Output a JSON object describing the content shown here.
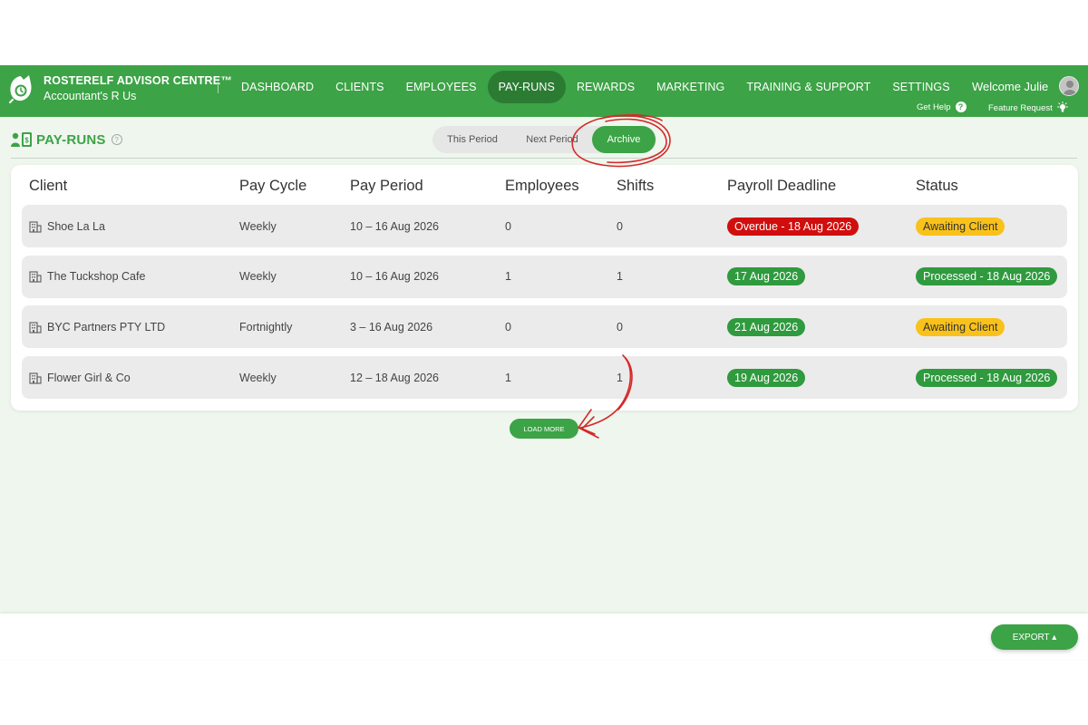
{
  "header": {
    "brand_title": "ROSTERELF ADVISOR CENTRE™",
    "brand_subtitle": "Accountant's R Us",
    "nav": [
      {
        "label": "DASHBOARD"
      },
      {
        "label": "CLIENTS"
      },
      {
        "label": "EMPLOYEES"
      },
      {
        "label": "PAY-RUNS",
        "active": true
      },
      {
        "label": "REWARDS"
      },
      {
        "label": "MARKETING"
      },
      {
        "label": "TRAINING & SUPPORT"
      },
      {
        "label": "SETTINGS"
      }
    ],
    "welcome": "Welcome Julie",
    "get_help": "Get Help",
    "feature_request": "Feature Request"
  },
  "page": {
    "title": "PAY-RUNS",
    "tabs": [
      {
        "label": "This Period"
      },
      {
        "label": "Next Period"
      },
      {
        "label": "Archive",
        "active": true
      }
    ]
  },
  "table": {
    "columns": [
      "Client",
      "Pay Cycle",
      "Pay Period",
      "Employees",
      "Shifts",
      "Payroll Deadline",
      "Status"
    ],
    "rows": [
      {
        "client": "Shoe La La",
        "cycle": "Weekly",
        "period": "10 – 16 Aug 2026",
        "employees": "0",
        "shifts": "0",
        "deadline": "Overdue - 18 Aug 2026",
        "deadline_state": "overdue",
        "status": "Awaiting Client",
        "status_state": "awaiting"
      },
      {
        "client": "The Tuckshop Cafe",
        "cycle": "Weekly",
        "period": "10 – 16 Aug 2026",
        "employees": "1",
        "shifts": "1",
        "deadline": "17 Aug 2026",
        "deadline_state": "ok",
        "status": "Processed - 18 Aug 2026",
        "status_state": "processed"
      },
      {
        "client": "BYC Partners PTY LTD",
        "cycle": "Fortnightly",
        "period": "3 – 16 Aug 2026",
        "employees": "0",
        "shifts": "0",
        "deadline": "21 Aug 2026",
        "deadline_state": "ok",
        "status": "Awaiting Client",
        "status_state": "awaiting"
      },
      {
        "client": "Flower Girl & Co",
        "cycle": "Weekly",
        "period": "12 – 18 Aug 2026",
        "employees": "1",
        "shifts": "1",
        "deadline": "19 Aug 2026",
        "deadline_state": "ok",
        "status": "Processed - 18 Aug 2026",
        "status_state": "processed"
      }
    ]
  },
  "load_more": "LOAD MORE",
  "export": "EXPORT ▴",
  "colors": {
    "brand_green": "#3ca346",
    "active_nav": "#2b7b33",
    "overdue_red": "#d10e0e",
    "ok_green": "#2f9a3e",
    "awaiting_yellow": "#f9c21b",
    "annotation_red": "#d42a2a"
  }
}
